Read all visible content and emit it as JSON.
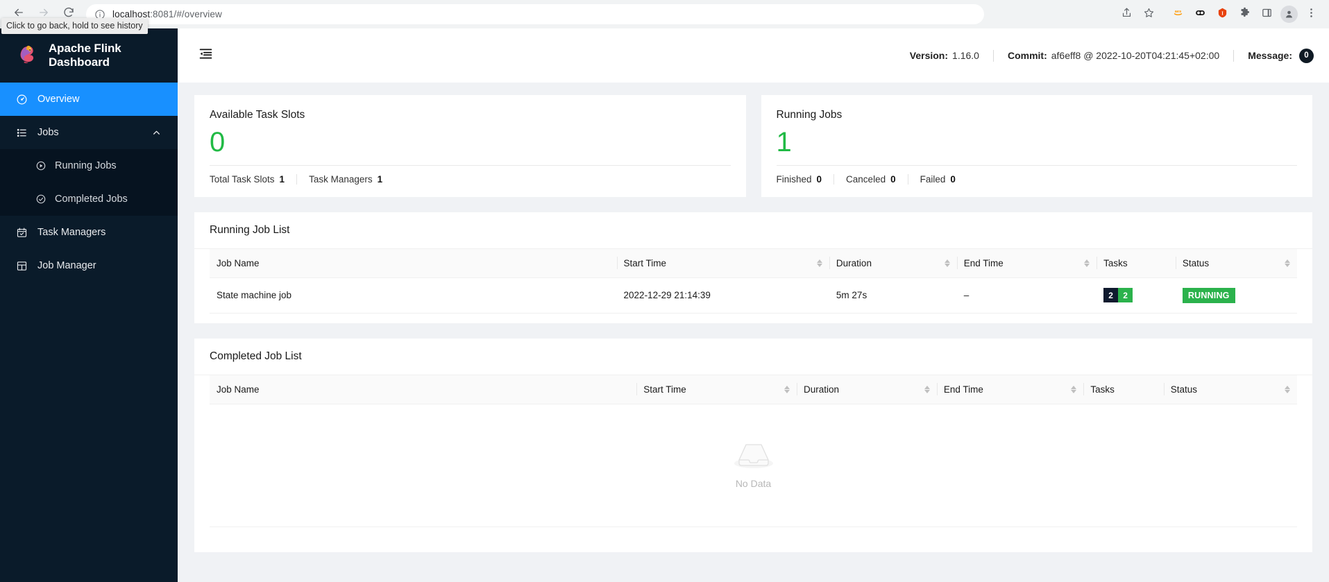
{
  "browser": {
    "url_host": "localhost",
    "url_path": ":8081/#/overview",
    "tooltip": "Click to go back, hold to see history",
    "back_icon": "back-arrow-icon",
    "forward_icon": "forward-arrow-icon",
    "reload_icon": "reload-icon",
    "info_icon": "site-info-icon",
    "share_icon": "share-icon",
    "bookmark_icon": "star-icon",
    "ext_aes_icon": "aes-extension-icon",
    "ext_dark_icon": "dark-reader-extension-icon",
    "ext_red_icon": "red-shield-extension-icon",
    "ext_puzzle_icon": "extensions-puzzle-icon",
    "ext_panel_icon": "side-panel-icon",
    "profile_icon": "profile-avatar-icon",
    "menu_icon": "chrome-menu-icon"
  },
  "sidebar": {
    "brand_title": "Apache Flink Dashboard",
    "logo_icon": "flink-squirrel-logo",
    "items": [
      {
        "label": "Overview",
        "icon": "dashboard-icon",
        "active": true
      },
      {
        "label": "Jobs",
        "icon": "list-icon",
        "active": false,
        "expanded": true,
        "chevron": "chevron-up-icon"
      },
      {
        "label": "Running Jobs",
        "icon": "play-circle-icon",
        "sub": true
      },
      {
        "label": "Completed Jobs",
        "icon": "check-circle-icon",
        "sub": true
      },
      {
        "label": "Task Managers",
        "icon": "calendar-check-icon",
        "active": false
      },
      {
        "label": "Job Manager",
        "icon": "grid-layout-icon",
        "active": false
      }
    ]
  },
  "topbar": {
    "fold_icon": "menu-fold-icon",
    "version_label": "Version:",
    "version_value": "1.16.0",
    "commit_label": "Commit:",
    "commit_value": "af6eff8 @ 2022-10-20T04:21:45+02:00",
    "message_label": "Message:",
    "message_count": "0"
  },
  "cards": {
    "task_slots": {
      "title": "Available Task Slots",
      "value": "0",
      "value_color": "#21ba45",
      "footer": [
        {
          "label": "Total Task Slots",
          "value": "1"
        },
        {
          "label": "Task Managers",
          "value": "1"
        }
      ]
    },
    "running_jobs": {
      "title": "Running Jobs",
      "value": "1",
      "value_color": "#21ba45",
      "footer": [
        {
          "label": "Finished",
          "value": "0"
        },
        {
          "label": "Canceled",
          "value": "0"
        },
        {
          "label": "Failed",
          "value": "0"
        }
      ]
    }
  },
  "running_job_list": {
    "title": "Running Job List",
    "columns": [
      "Job Name",
      "Start Time",
      "Duration",
      "End Time",
      "Tasks",
      "Status"
    ],
    "rows": [
      {
        "job_name": "State machine job",
        "start_time": "2022-12-29 21:14:39",
        "duration": "5m 27s",
        "end_time": "–",
        "tasks": [
          {
            "count": "2",
            "color": "#0f1a2e"
          },
          {
            "count": "2",
            "color": "#2bb24c"
          }
        ],
        "status": "RUNNING",
        "status_color": "#2bb24c"
      }
    ]
  },
  "completed_job_list": {
    "title": "Completed Job List",
    "columns": [
      "Job Name",
      "Start Time",
      "Duration",
      "End Time",
      "Tasks",
      "Status"
    ],
    "rows": [],
    "empty_text": "No Data",
    "empty_icon": "empty-inbox-icon"
  }
}
